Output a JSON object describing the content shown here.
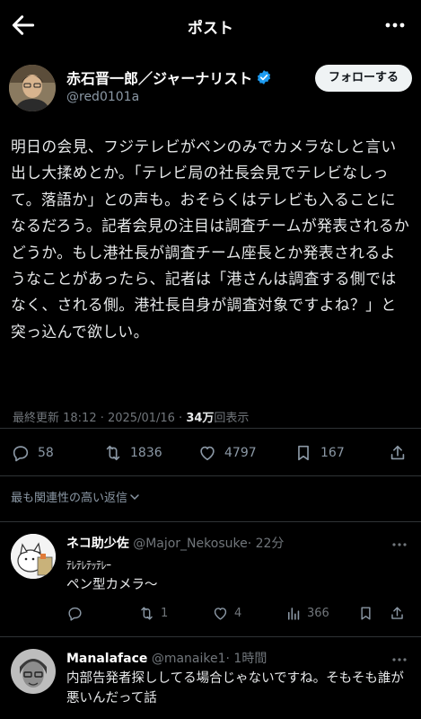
{
  "header": {
    "title": "ポスト"
  },
  "author": {
    "name": "赤石晋一郎／ジャーナリスト",
    "handle": "@red0101a",
    "follow_label": "フォローする"
  },
  "post": {
    "text": "明日の会見、フジテレビがペンのみでカメラなしと言い出し大揉めとか。「テレビ局の社長会見でテレビなしって。落語か」との声も。おそらくはテレビも入ることになるだろう。記者会見の注目は調査チームが発表されるかどうか。もし港社長が調査チーム座長とか発表されるようなことがあったら、記者は「港さんは調査する側ではなく、される側。港社長自身が調査対象ですよね？」と突っ込んで欲しい。",
    "meta_prefix": "最終更新 18:12 · 2025/01/16 · ",
    "views_count": "34万",
    "views_label": "回表示"
  },
  "stats": {
    "replies": "58",
    "reposts": "1836",
    "likes": "4797",
    "bookmarks": "167"
  },
  "sort_label": "最も関連性の高い返信",
  "replies": [
    {
      "name": "ネコ助少佐",
      "handle": "@Major_Nekosuke",
      "time": "· 22分",
      "text_line1": "ﾃﾚﾃﾚﾃｯﾃﾚｰ",
      "text_line2": "ペン型カメラ〜",
      "reposts": "1",
      "likes": "4",
      "views": "366"
    },
    {
      "name": "Manalaface",
      "handle": "@manaike1",
      "time": "· 1時間",
      "text": "内部告発者探ししてる場合じゃないですね。そもそも誰が悪いんだって話"
    }
  ],
  "colors": {
    "background": "#000000",
    "text": "#e7e9ea",
    "muted": "#71767b",
    "verified": "#1d9bf0",
    "divider": "#2f3336"
  }
}
